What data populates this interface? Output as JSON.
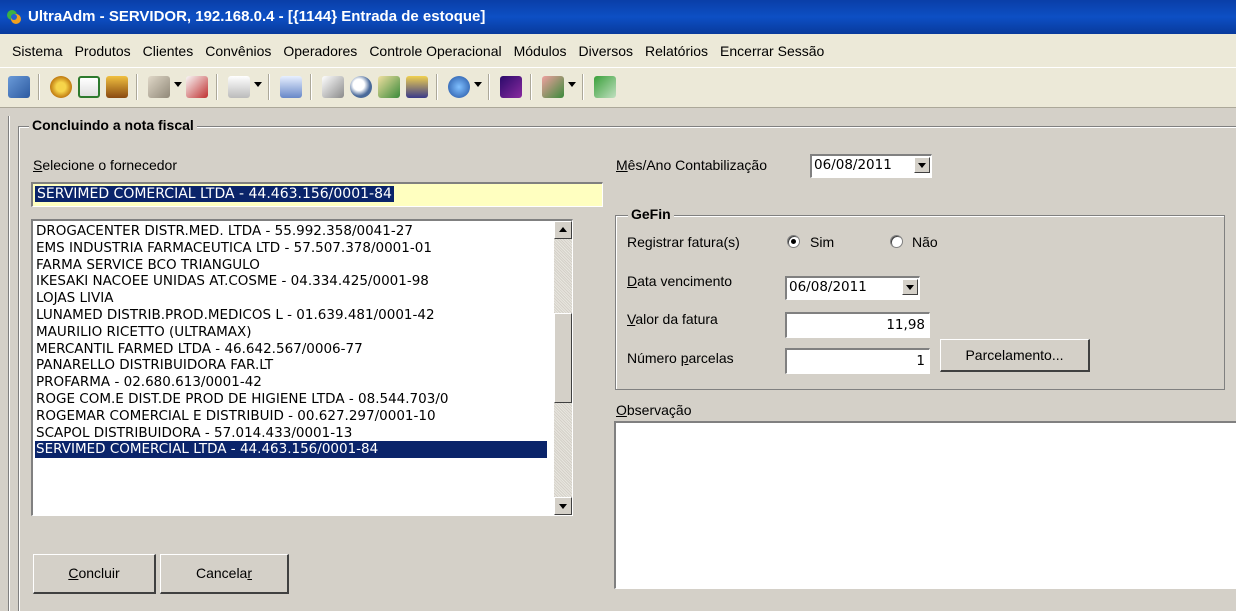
{
  "window": {
    "title": "UltraAdm - SERVIDOR, 192.168.0.4 - [{1144} Entrada de estoque]"
  },
  "menu": {
    "items": [
      "Sistema",
      "Produtos",
      "Clientes",
      "Convênios",
      "Operadores",
      "Controle Operacional",
      "Módulos",
      "Diversos",
      "Relatórios",
      "Encerrar Sessão"
    ]
  },
  "toolbar": {
    "icons": [
      "user-swap-icon",
      "settings-gear-icon",
      "calendar-icon",
      "paint-bucket-icon",
      "box-icon",
      "edit-icon",
      "hand-pointer-icon",
      "printer-icon",
      "invoice-icon",
      "magnifier-icon",
      "refresh-icon",
      "report-icon",
      "globe-icon",
      "chart-icon",
      "plugins-icon",
      "exit-icon"
    ]
  },
  "form": {
    "group_title": "Concluindo a nota fiscal",
    "supplier_label_key": "S",
    "supplier_label_rest": "elecione o fornecedor",
    "supplier_value": "SERVIMED COMERCIAL LTDA - 44.463.156/0001-84",
    "suppliers": [
      "DROGACENTER DISTR.MED. LTDA - 55.992.358/0041-27",
      "EMS INDUSTRIA FARMACEUTICA LTD - 57.507.378/0001-01",
      "FARMA SERVICE BCO TRIANGULO",
      "IKESAKI NACOEE UNIDAS AT.COSME - 04.334.425/0001-98",
      "LOJAS LIVIA",
      "LUNAMED DISTRIB.PROD.MEDICOS L - 01.639.481/0001-42",
      "MAURILIO RICETTO (ULTRAMAX)",
      "MERCANTIL FARMED LTDA - 46.642.567/0006-77",
      "PANARELLO DISTRIBUIDORA FAR.LT",
      "PROFARMA - 02.680.613/0001-42",
      "ROGE COM.E DIST.DE PROD DE HIGIENE LTDA - 08.544.703/0",
      "ROGEMAR COMERCIAL E DISTRIBUID - 00.627.297/0001-10",
      "SCAPOL DISTRIBUIDORA - 57.014.433/0001-13",
      "SERVIMED COMERCIAL LTDA - 44.463.156/0001-84"
    ],
    "concluir_key": "C",
    "concluir_rest": "oncluir",
    "cancelar_main": "Cancela",
    "cancelar_key": "r",
    "month_label_key": "M",
    "month_label_rest": "ês/Ano Contabilização",
    "month_value": "06/08/2011",
    "gefin": {
      "title": "GeFin",
      "registrar_label": "Registrar fatura(s)",
      "sim_label": "Sim",
      "nao_label": "Não",
      "vencimento_key": "D",
      "vencimento_rest": "ata vencimento",
      "vencimento_value": "06/08/2011",
      "valor_key": "V",
      "valor_rest": "alor da fatura",
      "valor_value": "11,98",
      "parcelas_main": "Número ",
      "parcelas_key": "p",
      "parcelas_rest": "arcelas",
      "parcelas_value": "1",
      "parcelamento_label": "Parcelamento..."
    },
    "obs_key": "O",
    "obs_rest": "bservação"
  },
  "colors": {
    "selection": "#0a246a",
    "input_highlight": "#ffffc0",
    "titlebar": "#0d4fc4"
  }
}
